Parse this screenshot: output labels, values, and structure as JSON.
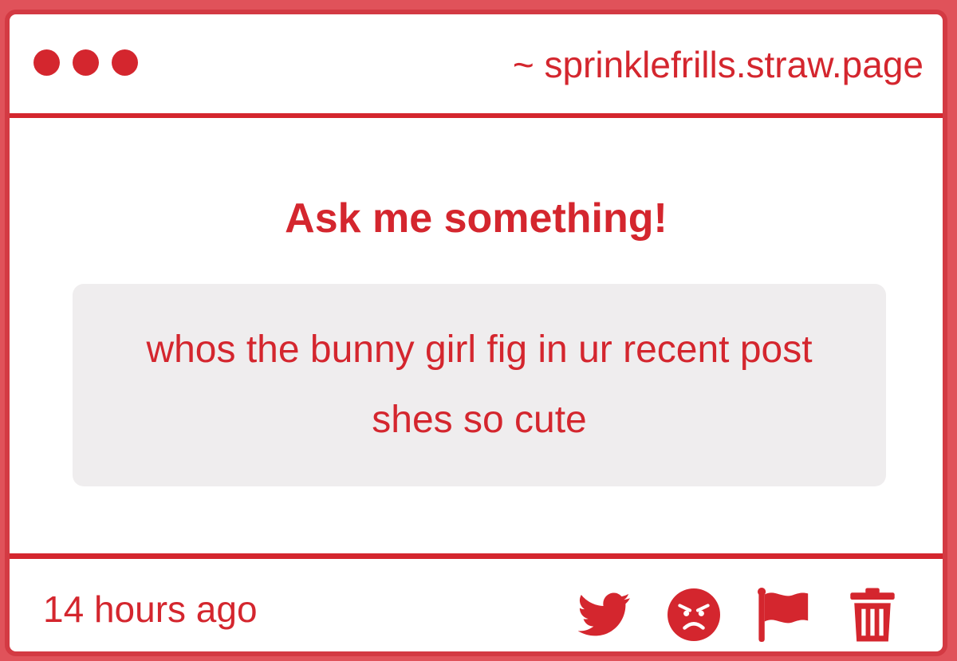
{
  "window": {
    "url": "~ sprinklefrills.straw.page"
  },
  "main": {
    "heading": "Ask me something!",
    "question": "whos the bunny girl fig in ur recent post shes so cute"
  },
  "footer": {
    "timestamp": "14 hours ago",
    "actions": [
      {
        "icon": "twitter-icon"
      },
      {
        "icon": "angry-face-icon"
      },
      {
        "icon": "flag-icon"
      },
      {
        "icon": "trash-icon"
      }
    ]
  },
  "colors": {
    "accent": "#d4262e",
    "box": "#efedee",
    "frame": "#e0525a"
  }
}
